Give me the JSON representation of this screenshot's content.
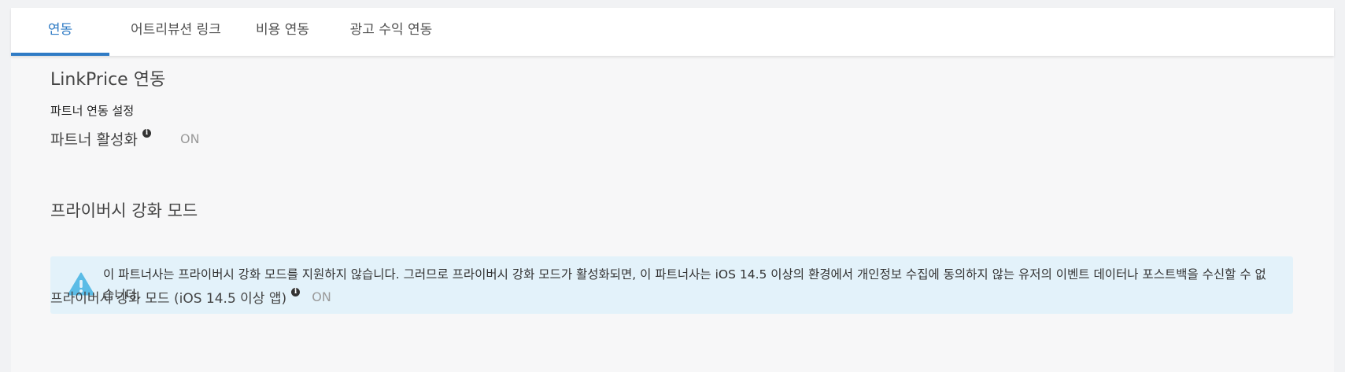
{
  "tabs": [
    {
      "label": "연동",
      "active": true
    },
    {
      "label": "어트리뷰션 링크",
      "active": false
    },
    {
      "label": "비용 연동",
      "active": false
    },
    {
      "label": "광고 수익 연동",
      "active": false
    }
  ],
  "integration": {
    "title": "LinkPrice 연동",
    "subtitle": "파트너 연동 설정",
    "partner_activation": {
      "label": "파트너 활성화",
      "value": "ON"
    }
  },
  "privacy": {
    "title": "프라이버시 강화 모드",
    "alert_text": "이 파트너사는 프라이버시 강화 모드를 지원하지 않습니다. 그러므로 프라이버시 강화 모드가 활성화되면, 이 파트너사는 iOS 14.5 이상의 환경에서 개인정보 수집에 동의하지 않는 유저의 이벤트 데이터나 포스트백을 수신할 수 없습니다.",
    "mode": {
      "label": "프라이버시 강화 모드 (iOS 14.5 이상 앱)",
      "value": "ON"
    }
  },
  "icons": {
    "info": "info-icon",
    "warning": "warning-icon"
  },
  "colors": {
    "accent": "#2f7bc5",
    "alert_bg": "#e3f2fa",
    "warning_icon": "#5bbce6",
    "value_text": "#9a9a9a"
  }
}
